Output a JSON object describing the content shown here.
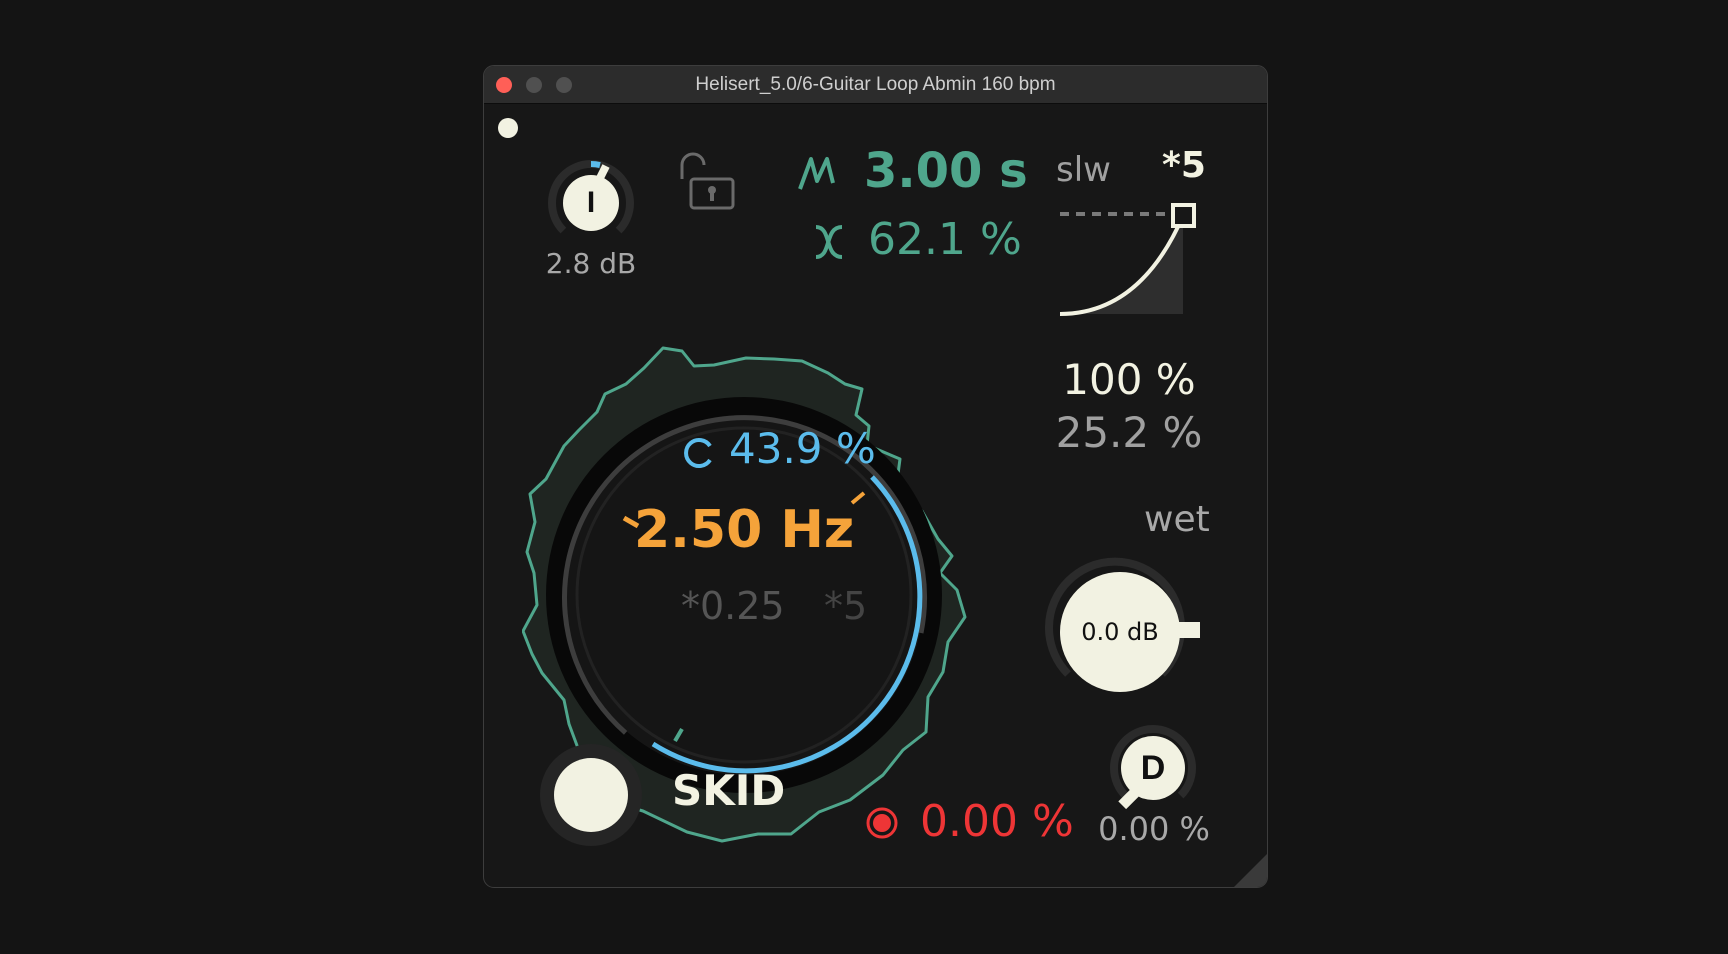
{
  "window": {
    "title": "Helisert_5.0/6-Guitar Loop Abmin 160 bpm"
  },
  "input_knob": {
    "glyph": "I",
    "value": "2.8 dB",
    "level": 0.42
  },
  "lock": {
    "icon": "unlocked-padlock-icon"
  },
  "time": {
    "value": "3.00 s",
    "icon": "zigzag-icon"
  },
  "mix": {
    "value": "62.1 %",
    "icon": "crossfade-icon"
  },
  "slew": {
    "label": "slw",
    "multiplier": "*5",
    "top_value": "100 %",
    "bottom_value": "25.2 %"
  },
  "dial": {
    "cycle_value": "43.9 %",
    "cycle_icon": "cycle-icon",
    "frequency": "2.50 Hz",
    "multiplier_left": "*0.25",
    "multiplier_right": "*5",
    "cycle_level": 0.439
  },
  "wet": {
    "label": "wet",
    "value": "0.0 dB"
  },
  "drive": {
    "glyph": "D",
    "value": "0.00 %"
  },
  "skid": {
    "label": "SKID"
  },
  "record": {
    "value": "0.00 %",
    "icon": "record-icon"
  },
  "colors": {
    "teal": "#4fa68c",
    "blue": "#5bbcec",
    "orange": "#f5a33a",
    "red": "#ee3536",
    "cream": "#f2f2e2",
    "background": "#171717"
  }
}
